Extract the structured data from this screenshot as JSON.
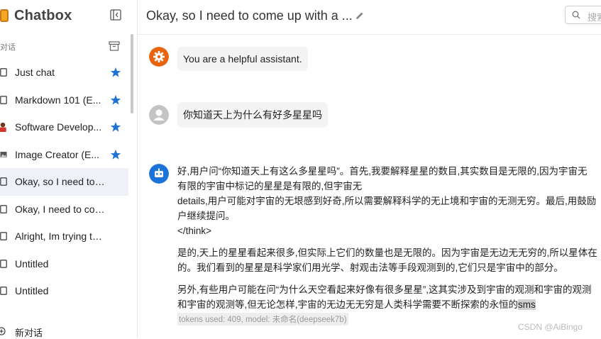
{
  "app": {
    "name": "Chatbox",
    "accent": "#1e73d8"
  },
  "sidebar": {
    "section_label": "对话",
    "items": [
      {
        "label": "Just chat",
        "icon": "chat-icon",
        "starred": true,
        "active": false
      },
      {
        "label": "Markdown 101 (E...",
        "icon": "chat-icon",
        "starred": true,
        "active": false
      },
      {
        "label": "Software Develop...",
        "icon": "developer-avatar-icon",
        "starred": true,
        "active": false
      },
      {
        "label": "Image Creator (E...",
        "icon": "image-icon",
        "starred": true,
        "active": false
      },
      {
        "label": "Okay, so I need to com...",
        "icon": "chat-icon",
        "starred": false,
        "active": true
      },
      {
        "label": "Okay, I need to come u...",
        "icon": "chat-icon",
        "starred": false,
        "active": false
      },
      {
        "label": "Alright, Im trying to figu...",
        "icon": "chat-icon",
        "starred": false,
        "active": false
      },
      {
        "label": "Untitled",
        "icon": "chat-icon",
        "starred": false,
        "active": false
      },
      {
        "label": "Untitled",
        "icon": "chat-icon",
        "starred": false,
        "active": false
      }
    ],
    "new_chat_label": "新对话"
  },
  "header": {
    "title": "Okay, so I need to come up with a ...",
    "search_placeholder": "搜索"
  },
  "messages": {
    "system": {
      "text": "You are a helpful assistant.",
      "avatar_color": "#e8650f"
    },
    "user": {
      "text": "你知道天上为什么有好多星星吗",
      "avatar_color": "#c4c4c4"
    },
    "assistant": {
      "avatar_color": "#1e73d8",
      "think_lines": [
        "好,用户问“你知道天上有这么多星星吗”。首先,我要解释星星的数目,其实数目是无限的,因为宇宙无",
        "有限的宇宙中标记的星星是有限的,但宇宙无",
        "details,用户可能对宇宙的无垠感到好奇,所以需要解释科学的无止境和宇宙的无测无穷。最后,用鼓励",
        "户继续提问。",
        "</think>"
      ],
      "para1_lines": [
        "是的,天上的星星看起来很多,但实际上它们的数量也是无限的。因为宇宙是无边无无穷的,所以星体在",
        "的。我们看到的星星是科学家们用光学、射观击法等手段观测到的,它们只是宇宙中的部分。"
      ],
      "para2_line1": "另外,有些用户可能在问“为什么天空看起来好像有很多星星”,这其实涉及到宇宙的观测和宇宙的观测",
      "para2_line2": "和宇宙的观测等,但无论怎样,宇宙的无边无无穷是人类科学需要不断探索的永恒的",
      "para2_highlight": "sms",
      "tokens": "tokens used: 409, model: 未命名(deepseek7b)"
    }
  },
  "watermark": "CSDN @AiBingo"
}
